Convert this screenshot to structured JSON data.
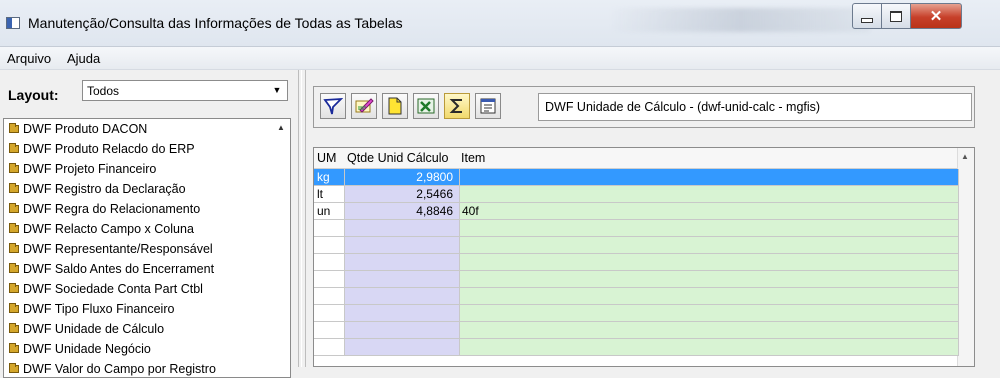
{
  "window": {
    "title": "Manutenção/Consulta das Informações de Todas as Tabelas",
    "close_glyph": "✕"
  },
  "menu": [
    "Arquivo",
    "Ajuda"
  ],
  "layout": {
    "label": "Layout:",
    "selected": "Todos",
    "arrow": "▼"
  },
  "tree": {
    "items": [
      "DWF Produto DACON",
      "DWF Produto Relacdo do ERP",
      "DWF Projeto Financeiro",
      "DWF Registro da Declaração",
      "DWF Regra do Relacionamento",
      "DWF Relacto Campo x Coluna",
      "DWF Representante/Responsável",
      "DWF Saldo Antes do Encerrament",
      "DWF Sociedade Conta Part Ctbl",
      "DWF Tipo Fluxo Financeiro",
      "DWF Unidade de Cálculo",
      "DWF Unidade Negócio",
      "DWF Valor do Campo por Registro"
    ],
    "scroll_up": "▲"
  },
  "toolbar": {
    "buttons": [
      "filter-icon",
      "edit-icon",
      "new-document-icon",
      "excel-icon",
      "sum-icon",
      "properties-icon"
    ],
    "table_name": "DWF Unidade de Cálculo - (dwf-unid-calc - mgfis)"
  },
  "grid": {
    "columns": [
      "UM",
      "Qtde Unid Cálculo",
      "Item"
    ],
    "rows": [
      {
        "um": "kg",
        "qtde": "2,9800",
        "item": "",
        "selected": true
      },
      {
        "um": "lt",
        "qtde": "2,5466",
        "item": ""
      },
      {
        "um": "un",
        "qtde": "4,8846",
        "item": "40f"
      },
      {
        "um": "",
        "qtde": "",
        "item": ""
      },
      {
        "um": "",
        "qtde": "",
        "item": ""
      },
      {
        "um": "",
        "qtde": "",
        "item": ""
      },
      {
        "um": "",
        "qtde": "",
        "item": ""
      },
      {
        "um": "",
        "qtde": "",
        "item": ""
      },
      {
        "um": "",
        "qtde": "",
        "item": ""
      },
      {
        "um": "",
        "qtde": "",
        "item": ""
      },
      {
        "um": "",
        "qtde": "",
        "item": ""
      }
    ],
    "scroll_up": "▲"
  },
  "colors": {
    "selection": "#3399ff",
    "qtde_column": "#d8d7f4",
    "item_column": "#d8f3d3",
    "close_button": "#c7402a"
  }
}
